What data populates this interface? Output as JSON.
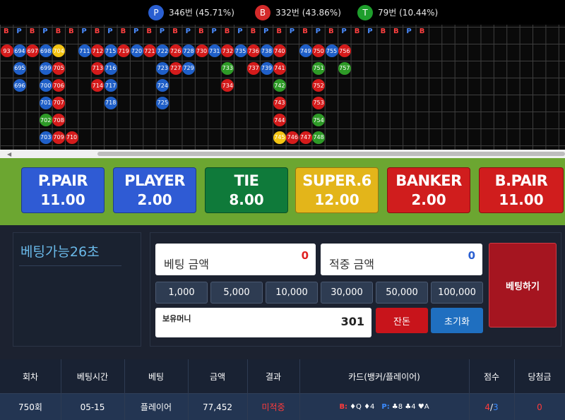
{
  "stats": {
    "player": {
      "letter": "P",
      "text": "346번 (45.71%)",
      "color": "#2a5fd1"
    },
    "banker": {
      "letter": "B",
      "text": "332번 (43.86%)",
      "color": "#d42a2a"
    },
    "tie": {
      "letter": "T",
      "text": "79번 (10.44%)",
      "color": "#1e9e2c"
    }
  },
  "road": {
    "header": [
      "B",
      "P",
      "B",
      "P",
      "B",
      "B",
      "P",
      "B",
      "P",
      "B",
      "P",
      "B",
      "P",
      "B",
      "P",
      "B",
      "P",
      "B",
      "P",
      "B",
      "P",
      "B",
      "P",
      "B",
      "P",
      "B",
      "P",
      "B",
      "P",
      "B",
      "B",
      "P",
      "B"
    ],
    "columns": [
      [
        [
          "93",
          "B"
        ]
      ],
      [
        [
          "694",
          "P"
        ],
        [
          "695",
          "P"
        ],
        [
          "696",
          "P"
        ]
      ],
      [
        [
          "697",
          "B"
        ]
      ],
      [
        [
          "698",
          "P"
        ],
        [
          "699",
          "P"
        ],
        [
          "700",
          "P"
        ],
        [
          "701",
          "P"
        ],
        [
          "702",
          "T"
        ],
        [
          "703",
          "P"
        ]
      ],
      [
        [
          "704",
          "Y"
        ],
        [
          "705",
          "B"
        ],
        [
          "706",
          "B"
        ],
        [
          "707",
          "B"
        ],
        [
          "708",
          "B"
        ],
        [
          "709",
          "B"
        ]
      ],
      [
        [
          "",
          "E"
        ],
        [
          "",
          "E"
        ],
        [
          "",
          "E"
        ],
        [
          "",
          "E"
        ],
        [
          "",
          "E"
        ],
        [
          "710",
          "B"
        ]
      ],
      [
        [
          "711",
          "P"
        ]
      ],
      [
        [
          "712",
          "B"
        ],
        [
          "713",
          "B"
        ],
        [
          "714",
          "B"
        ]
      ],
      [
        [
          "715",
          "P"
        ],
        [
          "716",
          "P"
        ],
        [
          "717",
          "P"
        ],
        [
          "718",
          "P"
        ]
      ],
      [
        [
          "719",
          "B"
        ]
      ],
      [
        [
          "720",
          "P"
        ]
      ],
      [
        [
          "721",
          "B"
        ]
      ],
      [
        [
          "722",
          "P"
        ],
        [
          "723",
          "P"
        ],
        [
          "724",
          "P"
        ],
        [
          "725",
          "P"
        ]
      ],
      [
        [
          "726",
          "B"
        ],
        [
          "727",
          "B"
        ]
      ],
      [
        [
          "728",
          "P"
        ],
        [
          "729",
          "P"
        ]
      ],
      [
        [
          "730",
          "B"
        ]
      ],
      [
        [
          "731",
          "P"
        ]
      ],
      [
        [
          "732",
          "B"
        ],
        [
          "733",
          "T"
        ],
        [
          "734",
          "B"
        ]
      ],
      [
        [
          "735",
          "P"
        ]
      ],
      [
        [
          "736",
          "B"
        ],
        [
          "737",
          "B"
        ]
      ],
      [
        [
          "738",
          "P"
        ],
        [
          "739",
          "P"
        ]
      ],
      [
        [
          "740",
          "B"
        ],
        [
          "741",
          "B"
        ],
        [
          "742",
          "T"
        ],
        [
          "743",
          "B"
        ],
        [
          "744",
          "B"
        ],
        [
          "745",
          "Y"
        ]
      ],
      [
        [
          "",
          "E"
        ],
        [
          "",
          "E"
        ],
        [
          "",
          "E"
        ],
        [
          "",
          "E"
        ],
        [
          "",
          "E"
        ],
        [
          "746",
          "B"
        ]
      ],
      [
        [
          "749",
          "P"
        ],
        [
          "",
          "E"
        ],
        [
          "",
          "E"
        ],
        [
          "",
          "E"
        ],
        [
          "",
          "E"
        ],
        [
          "747",
          "B"
        ]
      ],
      [
        [
          "750",
          "B"
        ],
        [
          "751",
          "T"
        ],
        [
          "752",
          "B"
        ],
        [
          "753",
          "B"
        ],
        [
          "754",
          "T"
        ],
        [
          "748",
          "T"
        ]
      ],
      [
        [
          "755",
          "P"
        ]
      ],
      [
        [
          "756",
          "B"
        ],
        [
          "757",
          "T"
        ]
      ]
    ]
  },
  "bets": [
    {
      "name": "P.PAIR",
      "odds": "11.00",
      "bg": "#2f5bd4"
    },
    {
      "name": "PLAYER",
      "odds": "2.00",
      "bg": "#2f5bd4"
    },
    {
      "name": "TIE",
      "odds": "8.00",
      "bg": "#0f7a3a"
    },
    {
      "name": "SUPER.6",
      "odds": "12.00",
      "bg": "#e3b51a"
    },
    {
      "name": "BANKER",
      "odds": "2.00",
      "bg": "#d01d1d"
    },
    {
      "name": "B.PAIR",
      "odds": "11.00",
      "bg": "#d01d1d"
    }
  ],
  "timer": "베팅가능26초",
  "bet_amount": {
    "label": "베팅 금액",
    "value": "0"
  },
  "win_amount": {
    "label": "적중 금액",
    "value": "0"
  },
  "chips": [
    "1,000",
    "5,000",
    "10,000",
    "30,000",
    "50,000",
    "100,000"
  ],
  "balance": {
    "label": "보유머니",
    "value": "301"
  },
  "buttons": {
    "change": "잔돈",
    "reset": "초기화",
    "bet": "베팅하기"
  },
  "history": {
    "headers": [
      "회차",
      "베팅시간",
      "베팅",
      "금액",
      "결과",
      "카드(뱅커/플레이어)",
      "점수",
      "당첨금"
    ],
    "row": {
      "round": "750회",
      "time": "05-15",
      "bet": "플레이어",
      "amount": "77,452",
      "result": "미적중",
      "cards_b": "B:",
      "cards_b_val": "♦Q ♦4",
      "cards_p": "P:",
      "cards_p_val": "♣8 ♣4 ♥A",
      "score_b": "4",
      "score_sep": "/",
      "score_p": "3",
      "payout": "0"
    }
  }
}
